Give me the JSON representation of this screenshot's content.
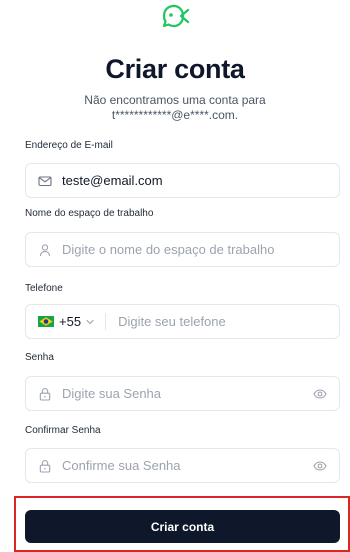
{
  "header": {
    "logo_icon": "fish-icon",
    "brand_color": "#22c55e",
    "title": "Criar conta",
    "subtitle": "Não encontramos uma conta para t************@e****.com."
  },
  "form": {
    "email": {
      "label": "Endereço de E-mail",
      "value": "teste@email.com",
      "icon": "mail-icon"
    },
    "workspace": {
      "label": "Nome do espaço de trabalho",
      "placeholder": "Digite o nome do espaço de trabalho",
      "icon": "user-icon"
    },
    "phone": {
      "label": "Telefone",
      "country_code": "+55",
      "country_flag": "brazil-flag-icon",
      "placeholder": "Digite seu telefone"
    },
    "password": {
      "label": "Senha",
      "placeholder": "Digite sua Senha",
      "icon": "lock-icon"
    },
    "confirm_password": {
      "label": "Confirmar Senha",
      "placeholder": "Confirme sua Senha",
      "icon": "lock-icon"
    },
    "submit_label": "Criar conta",
    "submit_color": "#0f172a",
    "highlight_color": "#dc2626"
  }
}
